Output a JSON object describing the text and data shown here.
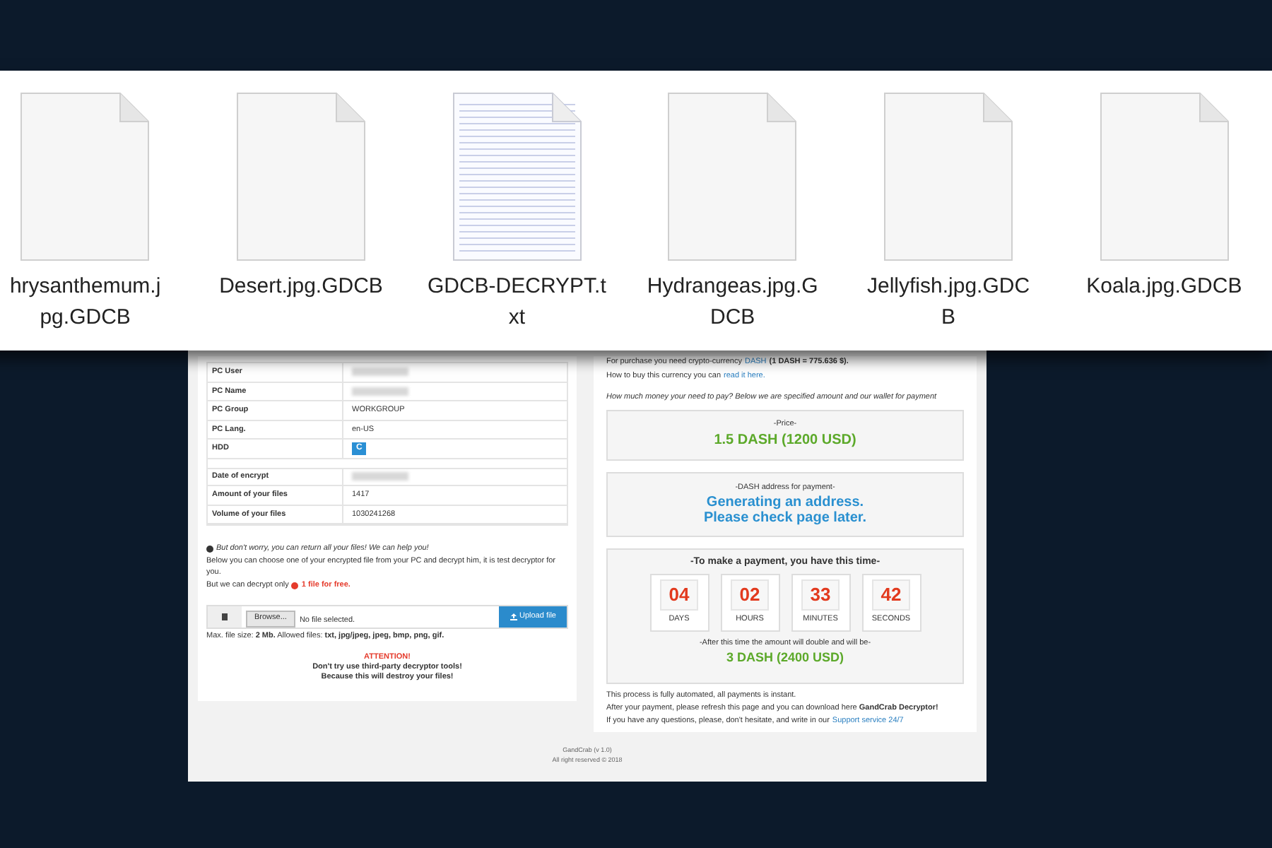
{
  "files": [
    {
      "kind": "blank",
      "lines": [
        "hrysanthemum.j",
        "pg.GDCB"
      ]
    },
    {
      "kind": "blank",
      "lines": [
        "Desert.jpg.GDCB"
      ]
    },
    {
      "kind": "text",
      "lines": [
        "GDCB-DECRYPT.t",
        "xt"
      ]
    },
    {
      "kind": "blank",
      "lines": [
        "Hydrangeas.jpg.G",
        "DCB"
      ]
    },
    {
      "kind": "blank",
      "lines": [
        "Jellyfish.jpg.GDC",
        "B"
      ]
    },
    {
      "kind": "blank",
      "lines": [
        "Koala.jpg.GDCB"
      ]
    }
  ],
  "info_rows": [
    {
      "label": "PC User",
      "kind": "blurred"
    },
    {
      "label": "PC Name",
      "kind": "blurred"
    },
    {
      "label": "PC Group",
      "kind": "text",
      "value": "WORKGROUP"
    },
    {
      "label": "PC Lang.",
      "kind": "text",
      "value": "en-US"
    },
    {
      "label": "HDD",
      "kind": "drive",
      "value": "C"
    },
    {
      "label": "Date of encrypt",
      "kind": "blurred",
      "gap": true
    },
    {
      "label": "Amount of your files",
      "kind": "text",
      "value": "1417"
    },
    {
      "label": "Volume of your files",
      "kind": "text",
      "value": "1030241268"
    }
  ],
  "free_decrypt": {
    "heading": "But don't worry, you can return all your files! We can help you!",
    "text": "Below you can choose one of your encrypted file from your PC and decrypt him, it is test decryptor for you.",
    "limit_text": "But we can decrypt only",
    "limit_highlight": "1 file for free.",
    "browse_button": "Browse...",
    "file_status": "No file selected.",
    "upload_button": "Upload file",
    "max_size": "Max. file size: **2 Mb.** Allowed files: **txt, jpg/jpeg, jpeg, bmp, png, gif.**",
    "attention": "ATTENTION!",
    "warning_1": "Don't try use third-party decryptor tools!",
    "warning_2": "Because this will destroy your files!"
  },
  "payment": {
    "purchase_text": "For purchase you need crypto-currency",
    "currency_link": "DASH",
    "rate": "(1 DASH = 775.636 $).",
    "howto_text": "How to buy this currency you can",
    "howto_link": "read it here.",
    "question": "How much money your need to pay? Below we are specified amount and our wallet for payment",
    "price_label": "-Price-",
    "price": "1.5 DASH (1200 USD)",
    "address_label": "-DASH address for payment-",
    "address_lines": [
      "Generating an address.",
      "Please check page later."
    ],
    "timer_title": "-To make a payment, you have this time-",
    "timer": [
      {
        "value": "04",
        "unit": "DAYS"
      },
      {
        "value": "02",
        "unit": "HOURS"
      },
      {
        "value": "33",
        "unit": "MINUTES"
      },
      {
        "value": "42",
        "unit": "SECONDS"
      }
    ],
    "double_label": "-After this time the amount will double and will be-",
    "double_price": "3 DASH (2400 USD)",
    "note_1": "This process is fully automated, all payments is instant.",
    "note_2": "After your payment, please refresh this page and you can download here **GandCrab Decryptor!**",
    "note_3": "If you have any questions, please, don't hesitate, and write in our",
    "support_link": "Support service 24/7"
  },
  "footer": {
    "version": "GandCrab (v 1.0)",
    "copyright": "All right reserved © 2018"
  }
}
